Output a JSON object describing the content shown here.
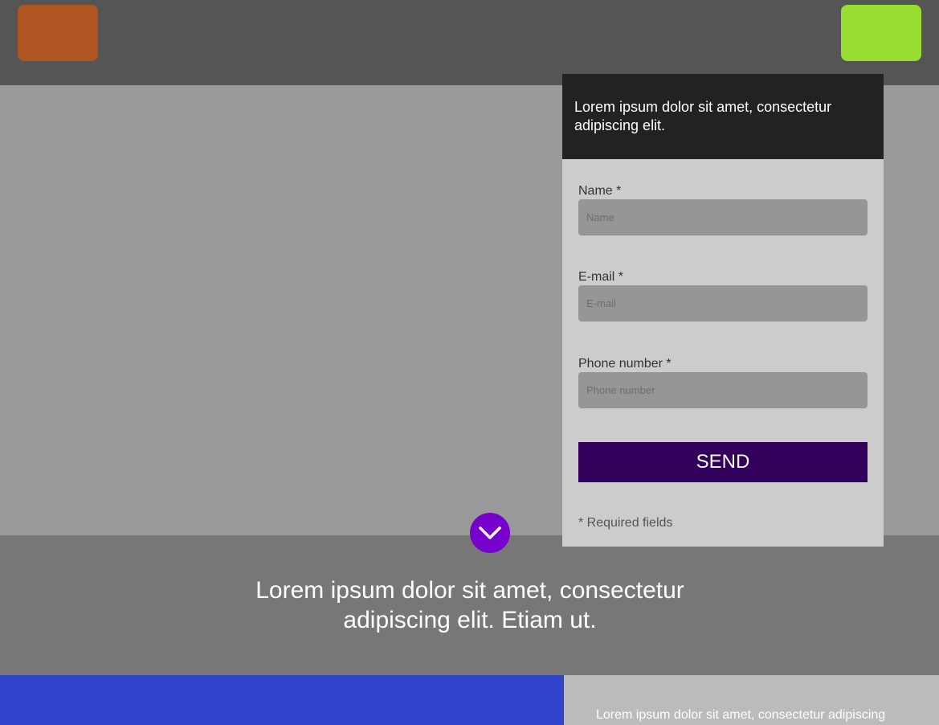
{
  "colors": {
    "logo_block": "#b05522",
    "header_cta": "#99dd33",
    "send_button": "#33005c",
    "scroll_button": "#7700cc",
    "bottom_left": "#3344cc"
  },
  "form": {
    "heading": "Lorem ipsum dolor sit amet, consectetur adipiscing elit.",
    "name_label": "Name *",
    "name_placeholder": "Name",
    "email_label": "E-mail *",
    "email_placeholder": "E-mail",
    "phone_label": "Phone number *",
    "phone_placeholder": "Phone number",
    "send_label": "SEND",
    "required_note": "* Required fields"
  },
  "scroll_button": {
    "icon": "chevron-down-icon"
  },
  "band": {
    "text": "Lorem ipsum dolor sit amet, consectetur adipiscing elit. Etiam ut."
  },
  "bottom": {
    "right_text": "Lorem ipsum dolor sit amet, consectetur adipiscing"
  }
}
